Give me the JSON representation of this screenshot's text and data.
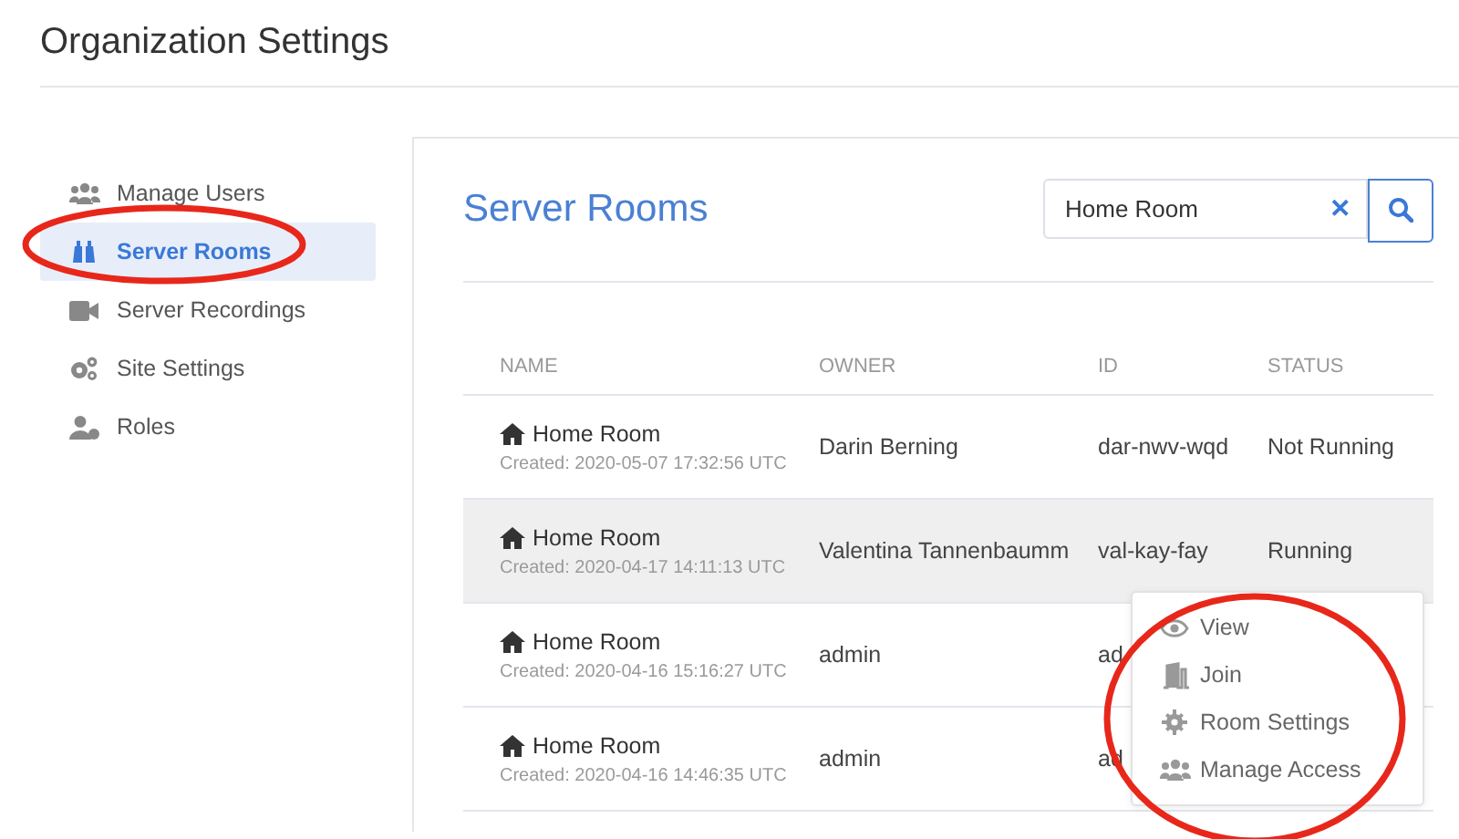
{
  "page": {
    "title": "Organization Settings"
  },
  "sidebar": {
    "items": [
      {
        "label": "Manage Users",
        "selected": false
      },
      {
        "label": "Server Rooms",
        "selected": true
      },
      {
        "label": "Server Recordings",
        "selected": false
      },
      {
        "label": "Site Settings",
        "selected": false
      },
      {
        "label": "Roles",
        "selected": false
      }
    ]
  },
  "panel": {
    "title": "Server Rooms",
    "search": {
      "value": "Home Room",
      "clear": "✕"
    },
    "table": {
      "columns": [
        "NAME",
        "OWNER",
        "ID",
        "STATUS"
      ],
      "rows": [
        {
          "name": "Home Room",
          "created": "Created: 2020-05-07 17:32:56 UTC",
          "owner": "Darin Berning",
          "id": "dar-nwv-wqd",
          "status": "Not Running",
          "highlighted": false
        },
        {
          "name": "Home Room",
          "created": "Created: 2020-04-17 14:11:13 UTC",
          "owner": "Valentina Tannenbaumm",
          "id": "val-kay-fay",
          "status": "Running",
          "highlighted": true
        },
        {
          "name": "Home Room",
          "created": "Created: 2020-04-16 15:16:27 UTC",
          "owner": "admin",
          "id": "ad",
          "highlighted": false
        },
        {
          "name": "Home Room",
          "created": "Created: 2020-04-16 14:46:35 UTC",
          "owner": "admin",
          "id": "ad",
          "highlighted": false
        }
      ]
    },
    "context_menu": {
      "items": [
        {
          "label": "View"
        },
        {
          "label": "Join"
        },
        {
          "label": "Room Settings"
        },
        {
          "label": "Manage Access"
        }
      ]
    }
  },
  "annotations": [
    {
      "kind": "ellipse"
    },
    {
      "kind": "ellipse"
    }
  ]
}
